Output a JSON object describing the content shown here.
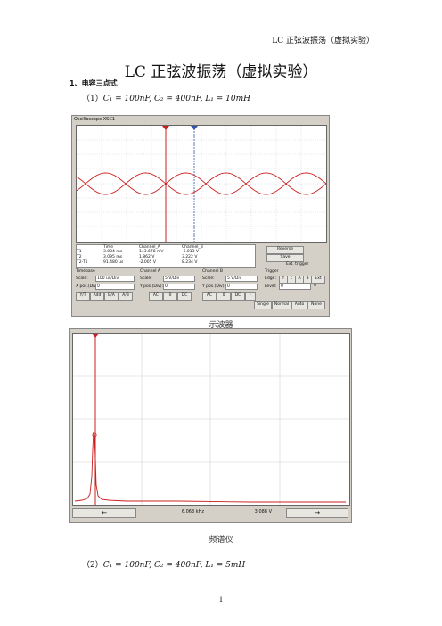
{
  "header": {
    "running_title": "LC 正弦波振荡（虚拟实验）"
  },
  "doc": {
    "title": "LC 正弦波振荡（虚拟实验）",
    "section": "1、电容三点式",
    "case1": {
      "num": "（1）",
      "formula": "C₁ = 100nF, C₂ = 400nF, L₁ = 10mH"
    },
    "case2": {
      "num": "（2）",
      "formula": "C₁ = 100nF, C₂ = 400nF, L₁ = 5mH"
    },
    "caption_osc": "示波器",
    "caption_spec": "频谱仪",
    "page_number": "1"
  },
  "oscilloscope": {
    "window_title": "Oscilloscope-XSC1",
    "readouts": {
      "cols": [
        "Time",
        "Channel_A",
        "Channel_B"
      ],
      "rows": [
        {
          "label": "T1",
          "time": "3.084 ms",
          "a": "143.678 mV",
          "b": "-6.013 V"
        },
        {
          "label": "T2",
          "time": "3.095 ms",
          "a": "1.862 V",
          "b": "3.222 V"
        },
        {
          "label": "T2-T1",
          "time": "91.480 us",
          "a": "-2.005 V",
          "b": "8.234 V"
        }
      ]
    },
    "buttons": {
      "reverse": "Reverse",
      "save": "Save",
      "ext_trigger": "Ext. trigger"
    },
    "timebase": {
      "title": "Timebase",
      "scale_label": "Scale:",
      "scale": "100 us/Div",
      "xpos_label": "X pos.(Div):",
      "xpos": "0",
      "modes": [
        "Y/T",
        "Add",
        "B/A",
        "A/B"
      ]
    },
    "channel_a": {
      "title": "Channel A",
      "scale_label": "Scale:",
      "scale": "5 V/Div",
      "ypos_label": "Y pos.(Div):",
      "ypos": "0",
      "modes": [
        "AC",
        "0",
        "DC"
      ]
    },
    "channel_b": {
      "title": "Channel B",
      "scale_label": "Scale:",
      "scale": "5 V/Div",
      "ypos_label": "Y pos.(Div):",
      "ypos": "0",
      "modes": [
        "AC",
        "0",
        "DC",
        "-"
      ]
    },
    "trigger": {
      "title": "Trigger",
      "edge_label": "Edge:",
      "level_label": "Level:",
      "level": "0",
      "level_unit": "V",
      "edge_buttons": [
        "f",
        "t",
        "A",
        "B",
        "Ext"
      ],
      "modes": [
        "Single",
        "Normal",
        "Auto",
        "None"
      ]
    },
    "colors": {
      "channel_a": "#cc1f1f",
      "channel_b": "#cc1f1f",
      "cursor_t1": "#cc1f1f",
      "cursor_t2": "#3355aa"
    }
  },
  "spectrum": {
    "frequency": "6.063 kHz",
    "amplitude": "3.088 V",
    "peak_marker": "1",
    "color": "#cc1f1f"
  }
}
